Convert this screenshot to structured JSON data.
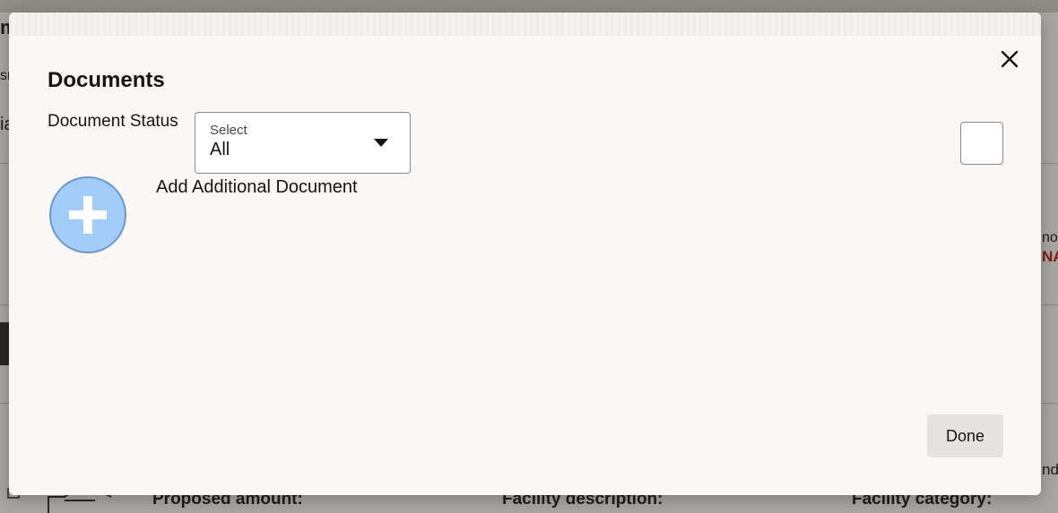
{
  "background": {
    "fragments": {
      "top_left": "m",
      "left_mid": "sr",
      "left_low": "ia",
      "right_a": "no",
      "right_b": "NA",
      "right_c": "nd",
      "proposed_amount": "Proposed amount:",
      "facility_description": "Facility description:",
      "facility_category": "Facility category:"
    }
  },
  "dialog": {
    "title": "Documents",
    "document_status_label": "Document Status",
    "select": {
      "caption": "Select",
      "value": "All"
    },
    "add_document_label": "Add Additional Document",
    "done_label": "Done"
  },
  "colors": {
    "add_button_fill": "#a3cdf9",
    "add_button_border": "#6898cc",
    "accent_red": "#7a1f12"
  }
}
